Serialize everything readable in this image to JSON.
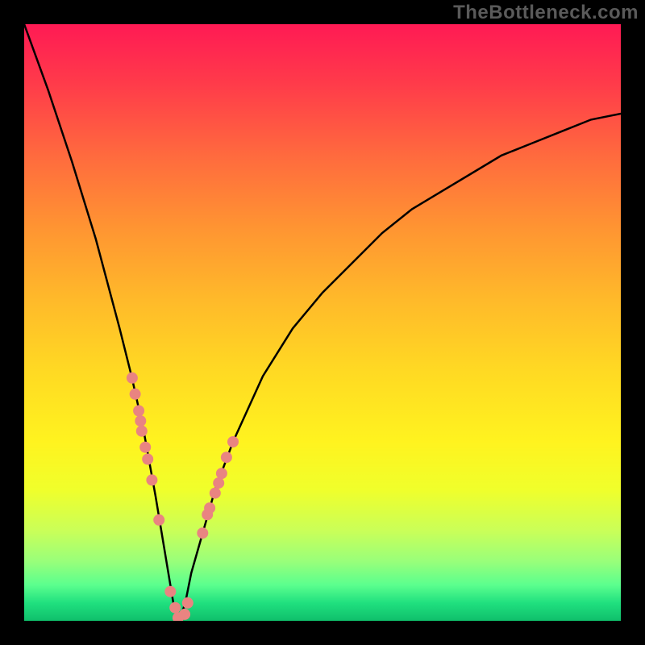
{
  "watermark": "TheBottleneck.com",
  "chart_data": {
    "type": "line",
    "title": "",
    "xlabel": "",
    "ylabel": "",
    "xlim": [
      0,
      100
    ],
    "ylim": [
      0,
      100
    ],
    "grid": false,
    "legend": false,
    "annotations": [],
    "series": [
      {
        "name": "bottleneck-curve",
        "x": [
          0,
          4,
          8,
          12,
          16,
          18,
          20,
          22,
          23,
          24,
          25,
          26,
          27,
          28,
          30,
          32,
          35,
          40,
          45,
          50,
          55,
          60,
          65,
          70,
          75,
          80,
          85,
          90,
          95,
          100
        ],
        "y": [
          100,
          89,
          77,
          64,
          49,
          41,
          32,
          21,
          15,
          9,
          3,
          0,
          3,
          8,
          15,
          22,
          30,
          41,
          49,
          55,
          60,
          65,
          69,
          72,
          75,
          78,
          80,
          82,
          84,
          85
        ]
      }
    ],
    "points": {
      "left": [
        {
          "x": 18.1,
          "y": 40.7
        },
        {
          "x": 18.6,
          "y": 38.0
        },
        {
          "x": 19.2,
          "y": 35.2
        },
        {
          "x": 19.5,
          "y": 33.5
        },
        {
          "x": 19.7,
          "y": 31.8
        },
        {
          "x": 20.3,
          "y": 29.1
        },
        {
          "x": 20.7,
          "y": 27.1
        },
        {
          "x": 21.4,
          "y": 23.6
        },
        {
          "x": 22.6,
          "y": 16.9
        }
      ],
      "bottom": [
        {
          "x": 24.5,
          "y": 4.9
        },
        {
          "x": 25.3,
          "y": 2.2
        },
        {
          "x": 25.8,
          "y": 0.5
        },
        {
          "x": 26.9,
          "y": 1.1
        },
        {
          "x": 27.4,
          "y": 3.0
        }
      ],
      "right": [
        {
          "x": 29.9,
          "y": 14.7
        },
        {
          "x": 30.7,
          "y": 17.8
        },
        {
          "x": 31.1,
          "y": 18.9
        },
        {
          "x": 32.0,
          "y": 21.4
        },
        {
          "x": 32.6,
          "y": 23.1
        },
        {
          "x": 33.1,
          "y": 24.7
        },
        {
          "x": 33.9,
          "y": 27.4
        },
        {
          "x": 35.0,
          "y": 30.0
        }
      ]
    },
    "background_gradient": {
      "type": "vertical",
      "stops": [
        {
          "pos": 0,
          "color": "#ff1a54"
        },
        {
          "pos": 10,
          "color": "#ff3b4a"
        },
        {
          "pos": 22,
          "color": "#ff6a3e"
        },
        {
          "pos": 34,
          "color": "#ff9432"
        },
        {
          "pos": 46,
          "color": "#ffb92a"
        },
        {
          "pos": 58,
          "color": "#ffd923"
        },
        {
          "pos": 70,
          "color": "#fff31f"
        },
        {
          "pos": 78,
          "color": "#f0ff2b"
        },
        {
          "pos": 85,
          "color": "#c9ff59"
        },
        {
          "pos": 90,
          "color": "#99ff7a"
        },
        {
          "pos": 94,
          "color": "#5bff8e"
        },
        {
          "pos": 97,
          "color": "#20e07f"
        },
        {
          "pos": 100,
          "color": "#0fbf6b"
        }
      ]
    },
    "colors": {
      "curve": "#000000",
      "dots": "#e98481",
      "frame": "#000000"
    }
  }
}
